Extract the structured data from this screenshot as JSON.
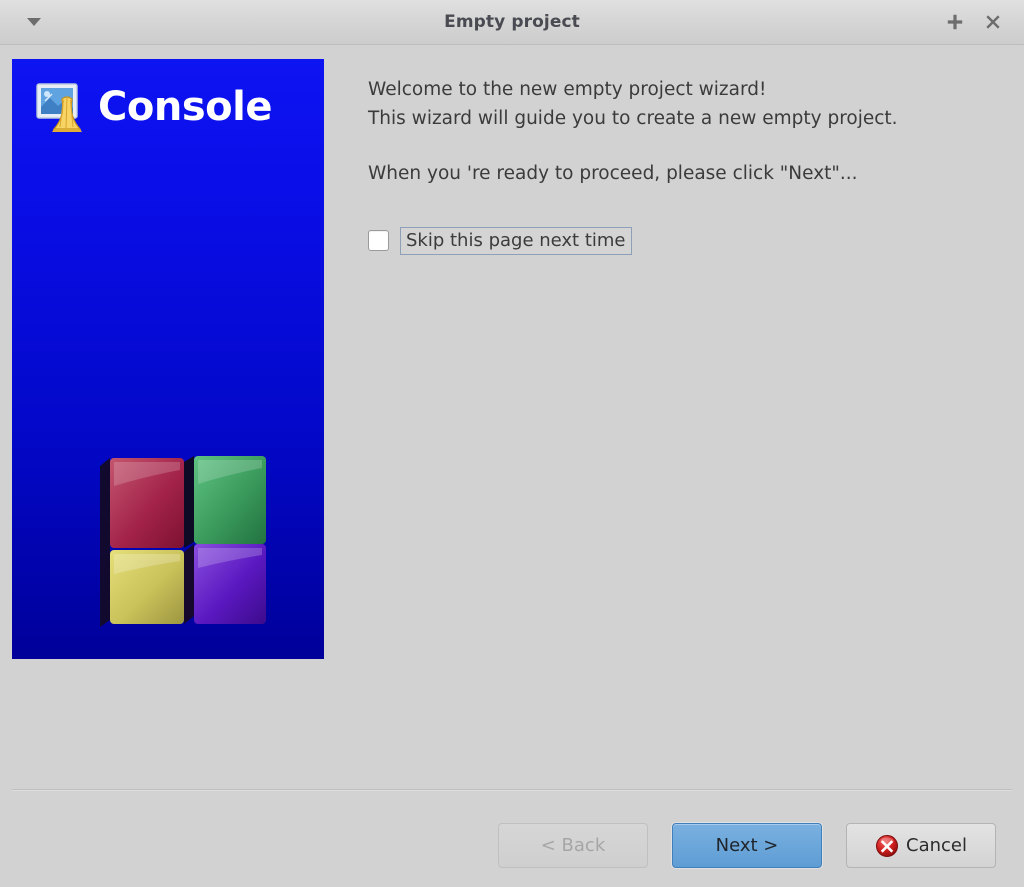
{
  "window": {
    "title": "Empty project",
    "titlebar_icons": {
      "menu": "chevron-down-icon",
      "add": "plus-icon",
      "close": "close-icon"
    }
  },
  "banner": {
    "logo_text": "Console",
    "logo_icon": "console-window-icon",
    "artwork": "four-cubes-logo",
    "colors": {
      "gradient_top": "#0d14f2",
      "gradient_bottom": "#000099",
      "cube_top_left": "#a3234a",
      "cube_top_right": "#3a9a5c",
      "cube_bottom_left": "#c9c159",
      "cube_bottom_right": "#5a18c0"
    }
  },
  "main": {
    "line1": "Welcome to the new empty project wizard!",
    "line2": "This wizard will guide you to create a new empty project.",
    "line3": "When you 're ready to proceed, please click \"Next\"...",
    "skip_checkbox": {
      "label": "Skip this page next time",
      "checked": false
    }
  },
  "footer": {
    "back_label": "< Back",
    "next_label": "Next >",
    "cancel_label": "Cancel",
    "cancel_icon": "error-circle-icon",
    "back_enabled": false,
    "accent_color": "#5e9dd4"
  }
}
